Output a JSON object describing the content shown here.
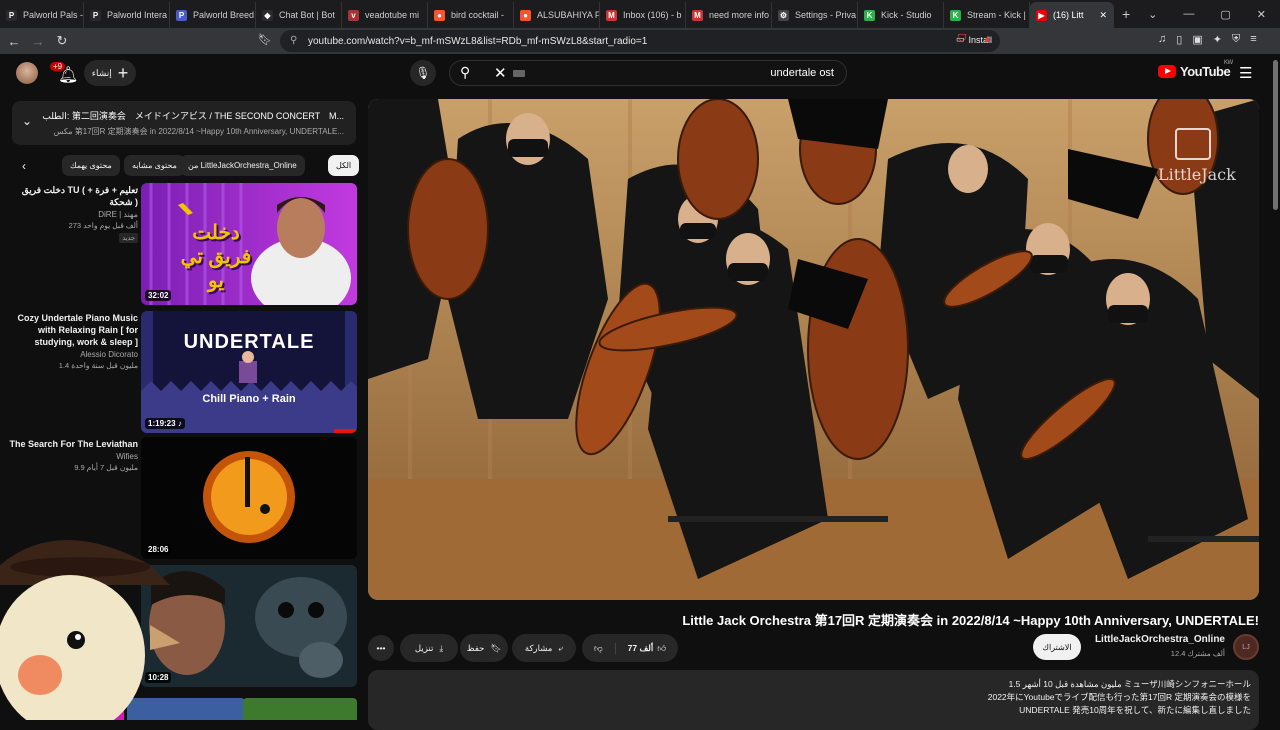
{
  "browser": {
    "tabs": [
      {
        "label": "Palworld Pals -",
        "icon": "P",
        "color": "#2a2a2a"
      },
      {
        "label": "Palworld Intera",
        "icon": "P",
        "color": "#2a2a2a"
      },
      {
        "label": "Palworld Breed",
        "icon": "P",
        "color": "#4a5cc8"
      },
      {
        "label": "Chat Bot | Bot",
        "icon": "◆",
        "color": "#2a2a2a"
      },
      {
        "label": "veadotube mi",
        "icon": "v",
        "color": "#a33"
      },
      {
        "label": "bird cocktail -",
        "icon": "●",
        "color": "#fb542b"
      },
      {
        "label": "ALSUBAHIYA P",
        "icon": "●",
        "color": "#fb542b"
      },
      {
        "label": "Inbox (106) - b",
        "icon": "M",
        "color": "#c33"
      },
      {
        "label": "need more info",
        "icon": "M",
        "color": "#c33"
      },
      {
        "label": "Settings - Priva",
        "icon": "⚙",
        "color": "#444"
      },
      {
        "label": "Kick - Studio",
        "icon": "K",
        "color": "#2db14a"
      },
      {
        "label": "Stream - Kick |",
        "icon": "K",
        "color": "#2db14a"
      },
      {
        "label": "(16) Litt",
        "icon": "▶",
        "color": "#e00"
      }
    ],
    "url": "youtube.com/watch?v=b_mf-mSWzL8&list=RDb_mf-mSWzL8&start_radio=1",
    "install_label": "Install"
  },
  "header": {
    "notif_count": "+9",
    "create_label": "إنشاء",
    "search_query": "undertale ost",
    "logo_text": "YouTube",
    "country_code": "KW"
  },
  "playlist": {
    "title": "الطلب: 第二回演奏会　メイドインアビス / THE SECOND CONCERT　M...",
    "subtitle": "مكس 第17回R 定期演奏会 in 2022/8/14 ~Happy 10th Anniversary, UNDERTALE..."
  },
  "chips": [
    "الكل",
    "من LittleJackOrchestra_Online",
    "محتوى مشابه",
    "محتوى يهمك"
  ],
  "recommendations": [
    {
      "title": "دخلت فريق TU ( تعليم + فرة + شحكة )",
      "channel": "DiRE | مهند",
      "meta": "273 ألف  قبل يوم واحد",
      "badge": "جديد",
      "duration": "32:02"
    },
    {
      "title": "Cozy Undertale Piano Music with Relaxing Rain [ for studying, work & sleep ]",
      "channel": "Alessio Dicorato",
      "meta": "1.4 مليون  قبل سنة واحدة",
      "badge": "",
      "duration": "1:19:23"
    },
    {
      "title": "The Search For The Leviathan",
      "channel": "Wifies",
      "meta": "9.9 مليون  قبل 7 أيام",
      "badge": "",
      "duration": "28:06"
    },
    {
      "title": "",
      "channel": "",
      "meta": "",
      "badge": "",
      "duration": "10:28"
    }
  ],
  "thumb_text": {
    "rec1": "دخلت فريق تي يو",
    "rec2_title": "UNDERTALE",
    "rec2_sub": "Chill Piano + Rain"
  },
  "video": {
    "title": "Little Jack Orchestra 第17回R 定期演奏会 in 2022/8/14 ~Happy 10th Anniversary, UNDERTALE!",
    "watermark": "LittleJack",
    "like_count": "77 ألف",
    "share_label": "مشاركة",
    "save_label": "حفظ",
    "download_label": "تنزيل",
    "channel_name": "LittleJackOrchestra_Online",
    "subscribers": "12.4 ألف مشترك",
    "subscribe_label": "الاشتراك",
    "desc_line1": "1.5 مليون مشاهدة  قبل 10 أشهر  ミューザ川崎シンフォニーホール",
    "desc_line2": "2022年にYoutubeでライブ配信も行った第17回R 定期演奏会の模様を",
    "desc_line3": "UNDERTALE 発売10周年を祝して、新たに編集し直しました"
  }
}
